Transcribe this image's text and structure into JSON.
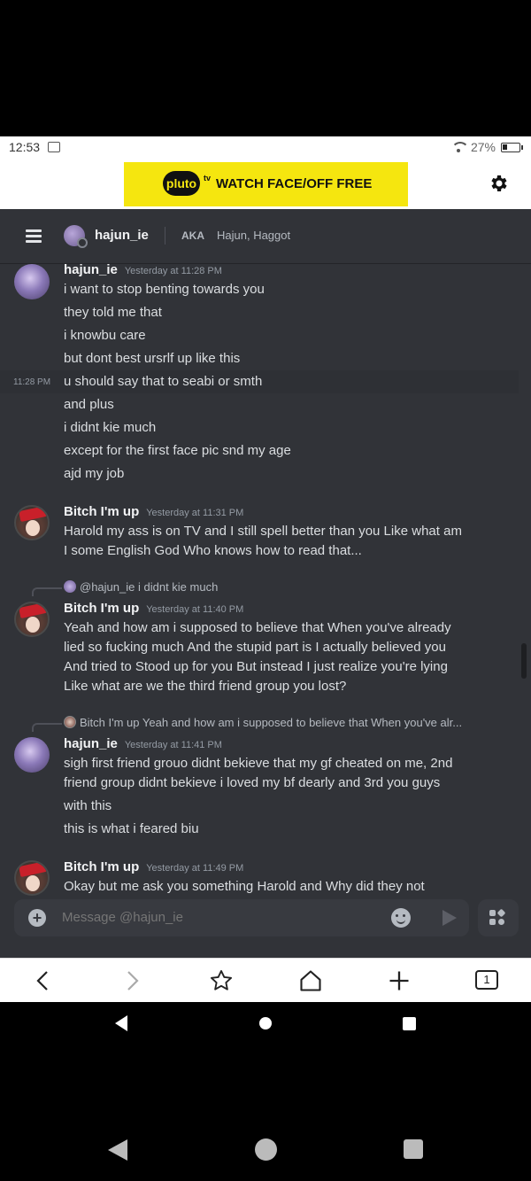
{
  "status_bar": {
    "time": "12:53",
    "battery": "27%"
  },
  "ad": {
    "brand": "pluto",
    "brand_sup": "tv",
    "text": "WATCH FACE/OFF FREE"
  },
  "header": {
    "username": "hajun_ie",
    "aka_label": "AKA",
    "aka_names": "Hajun, Haggot"
  },
  "messages": {
    "m1": {
      "author": "hajun_ie",
      "timestamp": "Yesterday at 11:28 PM",
      "lines": [
        "i want to stop benting towards you",
        "they told me that",
        "i knowbu care",
        "but dont best ursrlf up like this",
        "u should say that to seabi or smth",
        "and plus",
        "i didnt kie much",
        "except for the first face pic snd my age",
        "ajd my job"
      ],
      "side_time": "11:28 PM"
    },
    "m2": {
      "author": "Bitch I'm up",
      "timestamp": "Yesterday at 11:31 PM",
      "lines": [
        "Harold my ass is on TV and I still spell better than you Like what am",
        "I some English God Who knows how to read that..."
      ]
    },
    "m3": {
      "reply_author": "@hajun_ie",
      "reply_text": "i didnt kie much",
      "author": "Bitch I'm up",
      "timestamp": "Yesterday at 11:40 PM",
      "lines": [
        "Yeah and how am i supposed to believe that When you've already",
        "lied so fucking much And the stupid part is I actually believed you",
        "And tried to Stood up for you But instead I just realize you're lying",
        "Like what are we the third friend  group you lost?"
      ]
    },
    "m4": {
      "reply_author": "Bitch I'm up",
      "reply_text": "Yeah and how am i supposed to believe that When you've alr...",
      "author": "hajun_ie",
      "timestamp": "Yesterday at 11:41 PM",
      "lines": [
        "sigh first friend grouo didnt bekieve that my gf cheated on me, 2nd",
        "friend group didnt bekieve i loved my bf dearly and 3rd you guys",
        "with this",
        "this is what i feared biu"
      ]
    },
    "m5": {
      "author": "Bitch I'm up",
      "timestamp": "Yesterday at 11:49 PM",
      "lines": [
        "Okay but me ask you something Harold and Why did they not"
      ]
    }
  },
  "composer": {
    "placeholder": "Message @hajun_ie"
  },
  "browser_nav": {
    "tabs_count": "1"
  }
}
